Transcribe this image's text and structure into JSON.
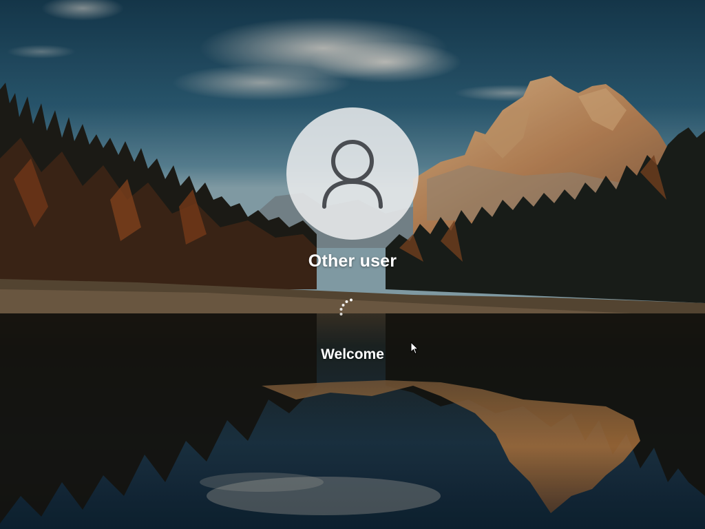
{
  "lock_screen": {
    "user_name": "Other user",
    "status_text": "Welcome",
    "user_avatar_icon": "person-icon",
    "progress_icon": "loading-spinner-icon",
    "pointer_icon": "mouse-pointer-icon"
  },
  "colors": {
    "avatar_circle": "#ebecee",
    "avatar_glyph": "#4a4d52",
    "text": "#ffffff"
  }
}
